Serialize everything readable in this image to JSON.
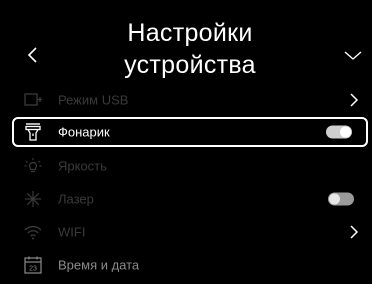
{
  "header": {
    "title_line1": "Настройки",
    "title_line2": "устройства",
    "back_icon": "chevron-left-icon",
    "menu_icon": "chevron-down-icon"
  },
  "menu": {
    "items": [
      {
        "label": "Режим USB",
        "icon": "usb-mode-icon",
        "control": "chevron"
      },
      {
        "label": "Фонарик",
        "icon": "flashlight-icon",
        "control": "toggle",
        "state": "on",
        "selected": true
      },
      {
        "label": "Яркость",
        "icon": "brightness-icon",
        "control": "none"
      },
      {
        "label": "Лазер",
        "icon": "laser-icon",
        "control": "toggle",
        "state": "off"
      },
      {
        "label": "WIFI",
        "icon": "wifi-icon",
        "control": "chevron"
      },
      {
        "label": "Время и дата",
        "icon": "calendar-icon",
        "control": "none",
        "icon_text": "23"
      }
    ]
  },
  "colors": {
    "background": "#000000",
    "text": "#ffffff",
    "dim": "#3a3a3a",
    "mid": "#8a8a8a"
  }
}
